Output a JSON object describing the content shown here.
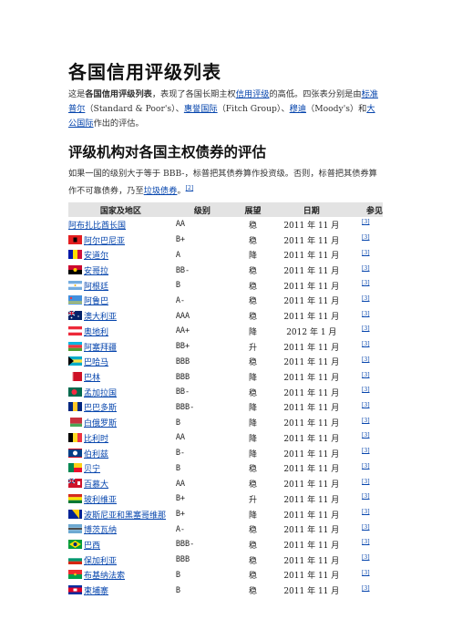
{
  "title": "各国信用评级列表",
  "intro": {
    "prefix": "这是",
    "bold": "各国信用评级列表",
    "mid1": "，表现了各国长期主权",
    "link1": "信用评级",
    "mid2": "的高低。四张表分别是由",
    "link2": "标准普尔",
    "mid3": "（Standard & Poor's）、",
    "link3": "惠誉国际",
    "mid4": "（Fitch Group）、",
    "link4": "穆迪",
    "mid5": "（Moody's）和",
    "link5": "大公国际",
    "suffix": "作出的评估。"
  },
  "section_title": "评级机构对各国主权债券的评估",
  "section_para": {
    "text": "如果一国的级别大于等于 BBB-，标普把其债券算作投资级。否则，标普把其债券算作不可靠债券，乃至",
    "link": "垃圾债券",
    "end": "。",
    "ref": "[2]"
  },
  "table": {
    "headers": [
      "国家及地区",
      "级别",
      "展望",
      "日期",
      "参见"
    ],
    "ref_label": "[3]",
    "rows": [
      {
        "name": "阿布扎比酋长国",
        "grade": "AA",
        "outlook": "稳",
        "date": "2011 年 11 月",
        "flag": "none"
      },
      {
        "name": "阿尔巴尼亚",
        "grade": "B+",
        "outlook": "稳",
        "date": "2011 年 11 月",
        "flag": "albania"
      },
      {
        "name": "安道尔",
        "grade": "A",
        "outlook": "降",
        "date": "2011 年 11 月",
        "flag": "andorra"
      },
      {
        "name": "安哥拉",
        "grade": "BB-",
        "outlook": "稳",
        "date": "2011 年 11 月",
        "flag": "angola"
      },
      {
        "name": "阿根廷",
        "grade": "B",
        "outlook": "稳",
        "date": "2011 年 11 月",
        "flag": "argentina"
      },
      {
        "name": "阿鲁巴",
        "grade": "A-",
        "outlook": "稳",
        "date": "2011 年 11 月",
        "flag": "aruba"
      },
      {
        "name": "澳大利亚",
        "grade": "AAA",
        "outlook": "稳",
        "date": "2011 年 11 月",
        "flag": "australia"
      },
      {
        "name": "奥地利",
        "grade": "AA+",
        "outlook": "降",
        "date": "2012 年 1 月",
        "flag": "austria"
      },
      {
        "name": "阿塞拜疆",
        "grade": "BB+",
        "outlook": "升",
        "date": "2011 年 11 月",
        "flag": "azerbaijan"
      },
      {
        "name": "巴哈马",
        "grade": "BBB",
        "outlook": "稳",
        "date": "2011 年 11 月",
        "flag": "bahamas"
      },
      {
        "name": "巴林",
        "grade": "BBB",
        "outlook": "降",
        "date": "2011 年 11 月",
        "flag": "bahrain"
      },
      {
        "name": "孟加拉国",
        "grade": "BB-",
        "outlook": "稳",
        "date": "2011 年 11 月",
        "flag": "bangladesh"
      },
      {
        "name": "巴巴多斯",
        "grade": "BBB-",
        "outlook": "降",
        "date": "2011 年 11 月",
        "flag": "barbados"
      },
      {
        "name": "白俄罗斯",
        "grade": "B",
        "outlook": "降",
        "date": "2011 年 11 月",
        "flag": "belarus"
      },
      {
        "name": "比利时",
        "grade": "AA",
        "outlook": "降",
        "date": "2011 年 11 月",
        "flag": "belgium"
      },
      {
        "name": "伯利兹",
        "grade": "B-",
        "outlook": "降",
        "date": "2011 年 11 月",
        "flag": "belize"
      },
      {
        "name": "贝宁",
        "grade": "B",
        "outlook": "稳",
        "date": "2011 年 11 月",
        "flag": "benin"
      },
      {
        "name": "百慕大",
        "grade": "AA",
        "outlook": "稳",
        "date": "2011 年 11 月",
        "flag": "bermuda"
      },
      {
        "name": "玻利维亚",
        "grade": "B+",
        "outlook": "升",
        "date": "2011 年 11 月",
        "flag": "bolivia"
      },
      {
        "name": "波斯尼亚和黑塞哥维那",
        "grade": "B+",
        "outlook": "降",
        "date": "2011 年 11 月",
        "flag": "bosnia"
      },
      {
        "name": "博茨瓦纳",
        "grade": "A-",
        "outlook": "稳",
        "date": "2011 年 11 月",
        "flag": "botswana"
      },
      {
        "name": "巴西",
        "grade": "BBB-",
        "outlook": "稳",
        "date": "2011 年 11 月",
        "flag": "brazil"
      },
      {
        "name": "保加利亚",
        "grade": "BBB",
        "outlook": "稳",
        "date": "2011 年 11 月",
        "flag": "bulgaria"
      },
      {
        "name": "布基纳法索",
        "grade": "B",
        "outlook": "稳",
        "date": "2011 年 11 月",
        "flag": "burkina"
      },
      {
        "name": "柬埔寨",
        "grade": "B",
        "outlook": "稳",
        "date": "2011 年 11 月",
        "flag": "cambodia"
      }
    ]
  },
  "colors": {
    "link": "#0645ad",
    "header_bg": "#e3e3e3"
  }
}
